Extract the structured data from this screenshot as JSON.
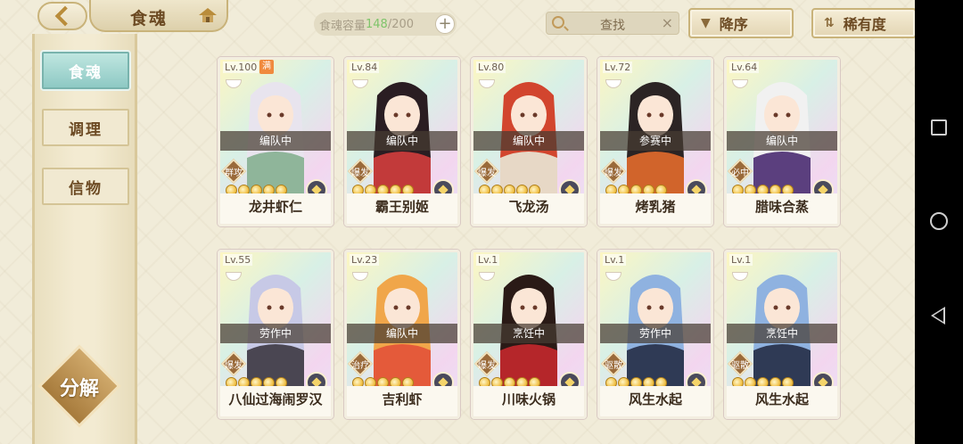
{
  "header": {
    "title": "食魂",
    "capacity_label": "食魂容量",
    "capacity_current": "148",
    "capacity_max": "/200",
    "capacity_add": "+",
    "search_label": "查找",
    "search_clear": "×",
    "sort_order_label": "降序",
    "sort_order_icon": "▼",
    "sort_by_label": "稀有度",
    "sort_by_icon": "⇅"
  },
  "sidebar": {
    "items": [
      {
        "label": "食魂",
        "active": true
      },
      {
        "label": "调理",
        "active": false
      },
      {
        "label": "信物",
        "active": false
      }
    ],
    "decompose_label": "分解"
  },
  "colors": {
    "accent_teal": "#8ec9c4",
    "panel_gold": "#c9b37a",
    "text_brown": "#6c4a23",
    "capacity_green": "#7fc46a"
  },
  "cards": [
    {
      "level": "Lv.100",
      "max_badge": "满",
      "status": "编队中",
      "type": "群攻",
      "stars": 5,
      "name": "龙井虾仁",
      "hair": "#e8e4ee",
      "outfit": "#8fb59a"
    },
    {
      "level": "Lv.84",
      "status": "编队中",
      "type": "爆发",
      "stars": 5,
      "name": "霸王别姬",
      "hair": "#2a1d22",
      "outfit": "#c23a3a"
    },
    {
      "level": "Lv.80",
      "status": "编队中",
      "type": "爆发",
      "stars": 5,
      "name": "飞龙汤",
      "hair": "#d2452e",
      "outfit": "#e7d8c6"
    },
    {
      "level": "Lv.72",
      "status": "参赛中",
      "type": "爆发",
      "stars": 5,
      "name": "烤乳猪",
      "hair": "#2b2424",
      "outfit": "#d1642b"
    },
    {
      "level": "Lv.64",
      "status": "编队中",
      "type": "必中",
      "stars": 5,
      "name": "腊味合蒸",
      "hair": "#f1f1f1",
      "outfit": "#5b3f7e"
    },
    {
      "level": "Lv.55",
      "status": "劳作中",
      "type": "爆发",
      "stars": 5,
      "name": "八仙过海闹罗汉",
      "hair": "#c7c9e6",
      "outfit": "#4a4652"
    },
    {
      "level": "Lv.23",
      "status": "编队中",
      "type": "治疗",
      "stars": 5,
      "name": "吉利虾",
      "hair": "#f0a64a",
      "outfit": "#e45a3a"
    },
    {
      "level": "Lv.1",
      "status": "烹饪中",
      "type": "爆发",
      "stars": 5,
      "name": "川味火锅",
      "hair": "#2a1a16",
      "outfit": "#b5262a"
    },
    {
      "level": "Lv.1",
      "status": "劳作中",
      "type": "驱散",
      "stars": 5,
      "name": "风生水起",
      "hair": "#8fb2e0",
      "outfit": "#2f3a55"
    },
    {
      "level": "Lv.1",
      "status": "烹饪中",
      "type": "驱散",
      "stars": 5,
      "name": "风生水起",
      "hair": "#8fb2e0",
      "outfit": "#2f3a55"
    }
  ]
}
